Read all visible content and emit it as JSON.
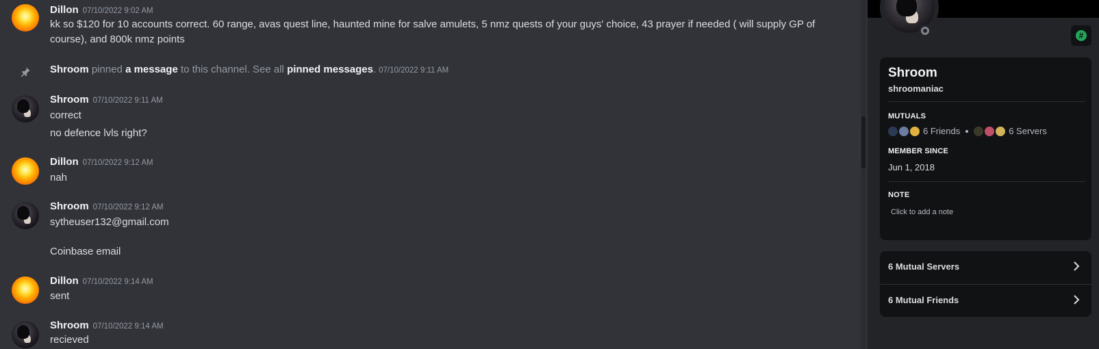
{
  "chat": {
    "messages": [
      {
        "author": "Dillon",
        "timestamp": "07/10/2022 9:02 AM",
        "lines": [
          "kk so $120 for 10 accounts correct. 60 range, avas quest line, haunted mine for salve amulets, 5 nmz quests of your guys' choice, 43 prayer if needed ( will supply GP of course), and 800k nmz points"
        ]
      },
      {
        "system": {
          "author": "Shroom",
          "pre": " pinned ",
          "link1": "a message",
          "mid": " to this channel. See all ",
          "link2": "pinned messages",
          "post": ".",
          "timestamp": "07/10/2022 9:11 AM"
        }
      },
      {
        "author": "Shroom",
        "timestamp": "07/10/2022 9:11 AM",
        "lines": [
          "correct",
          "no defence lvls right?"
        ]
      },
      {
        "author": "Dillon",
        "timestamp": "07/10/2022 9:12 AM",
        "lines": [
          "nah"
        ]
      },
      {
        "author": "Shroom",
        "timestamp": "07/10/2022 9:12 AM",
        "lines": [
          "sytheuser132@gmail.com",
          "Coinbase email"
        ]
      },
      {
        "author": "Dillon",
        "timestamp": "07/10/2022 9:14 AM",
        "lines": [
          "sent"
        ]
      },
      {
        "author": "Shroom",
        "timestamp": "07/10/2022 9:14 AM",
        "lines": [
          "recieved"
        ]
      }
    ]
  },
  "profile": {
    "display_name": "Shroom",
    "username": "shroomaniac",
    "status": "offline",
    "badge_icon": "hashtag-badge-icon",
    "mutuals_heading": "MUTUALS",
    "mutual_friends": "6 Friends",
    "mutual_servers": "6 Servers",
    "member_since_heading": "MEMBER SINCE",
    "member_since": "Jun 1, 2018",
    "note_heading": "NOTE",
    "note_placeholder": "Click to add a note",
    "buttons": [
      {
        "label": "6 Mutual Servers",
        "icon": "chevron-right-icon"
      },
      {
        "label": "6 Mutual Friends",
        "icon": "chevron-right-icon"
      }
    ]
  },
  "colors": {
    "chat_bg": "#323339",
    "panel_bg": "#232428",
    "card_bg": "#111214",
    "author": "#f2f3f5",
    "timestamp": "#949ba4",
    "online_green": "#23a55a"
  }
}
